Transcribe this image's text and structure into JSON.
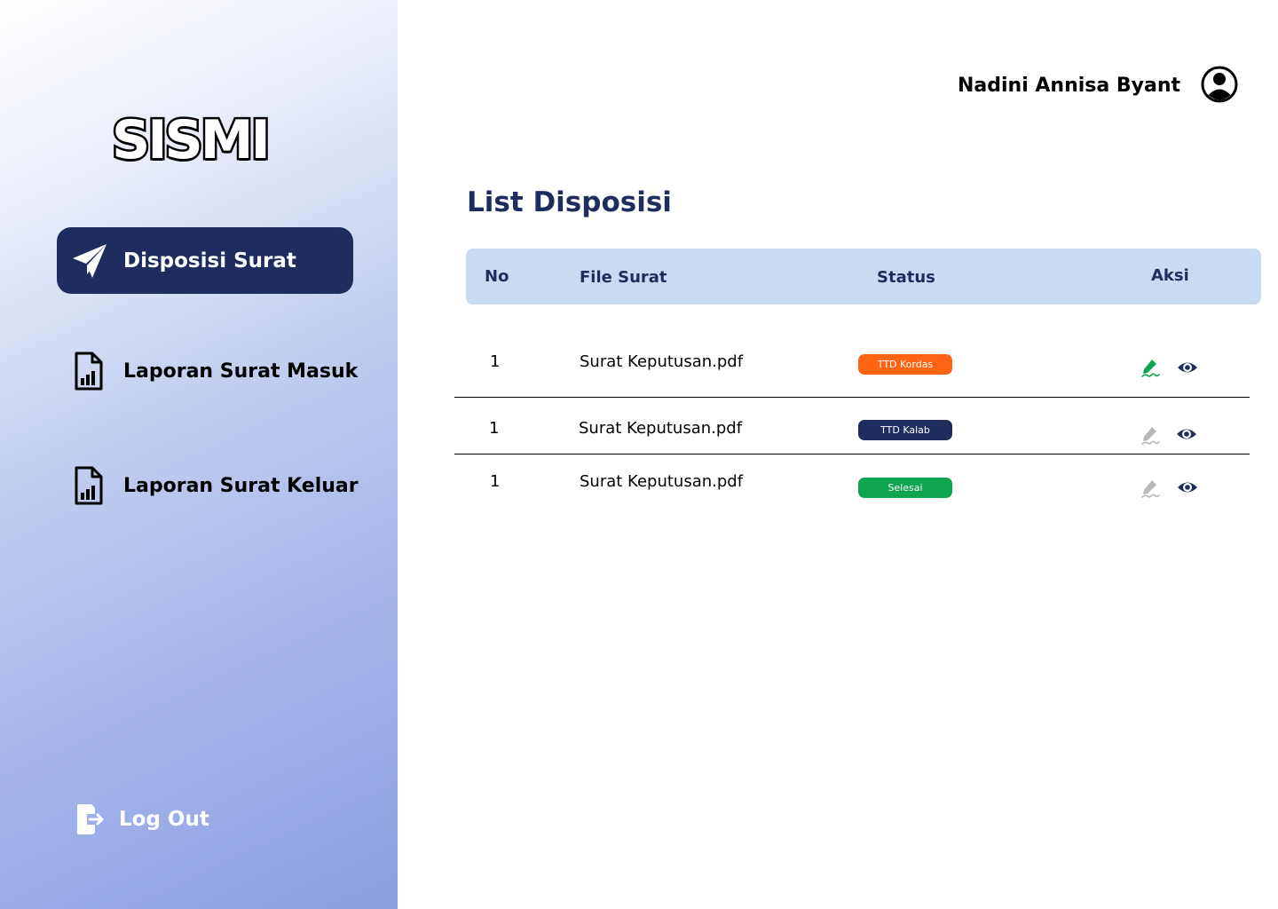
{
  "app": {
    "logo_text": "SISMI"
  },
  "sidebar": {
    "items": [
      {
        "label": "Disposisi Surat",
        "icon": "paper-plane-icon",
        "active": true
      },
      {
        "label": "Laporan Surat Masuk",
        "icon": "document-chart-icon",
        "active": false
      },
      {
        "label": "Laporan Surat Keluar",
        "icon": "document-chart-icon",
        "active": false
      }
    ],
    "logout_label": "Log Out"
  },
  "header": {
    "user_name": "Nadini Annisa Byant",
    "avatar_icon": "user-circle-icon"
  },
  "main": {
    "title": "List Disposisi",
    "table": {
      "columns": [
        "No",
        "File Surat",
        "Status",
        "Aksi"
      ],
      "rows": [
        {
          "no": "1",
          "file": "Surat Keputusan.pdf",
          "status": "TTD Kordas",
          "status_color": "#ff6314",
          "sign_enabled": true
        },
        {
          "no": "1",
          "file": "Surat Keputusan.pdf",
          "status": "TTD Kalab",
          "status_color": "#1e2d5e",
          "sign_enabled": false
        },
        {
          "no": "1",
          "file": "Surat Keputusan.pdf",
          "status": "Selesai",
          "status_color": "#10a64f",
          "sign_enabled": false
        }
      ]
    }
  },
  "colors": {
    "primary": "#1e2d5e",
    "table_header": "#c9dbf3",
    "sign_active": "#10a64f",
    "sign_disabled": "#b8b8b8"
  }
}
